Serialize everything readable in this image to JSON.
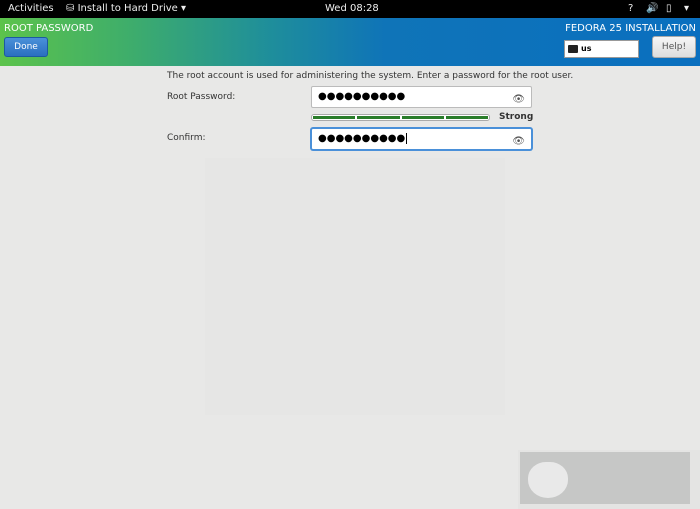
{
  "topbar": {
    "activities": "Activities",
    "app_menu": "Install to Hard Drive",
    "clock": "Wed 08:28"
  },
  "header": {
    "title": "ROOT PASSWORD",
    "product": "FEDORA 25 INSTALLATION",
    "done": "Done",
    "keyboard_layout": "us",
    "help": "Help!"
  },
  "form": {
    "description": "The root account is used for administering the system.  Enter a password for the root user.",
    "root_password_label": "Root Password:",
    "root_password_value": "●●●●●●●●●●",
    "confirm_label": "Confirm:",
    "confirm_value": "●●●●●●●●●●",
    "strength_label": "Strong",
    "strength_segments_filled": 4,
    "strength_segments_total": 4
  },
  "colors": {
    "accent": "#4a90d9",
    "strength": "#2a7d2a"
  }
}
